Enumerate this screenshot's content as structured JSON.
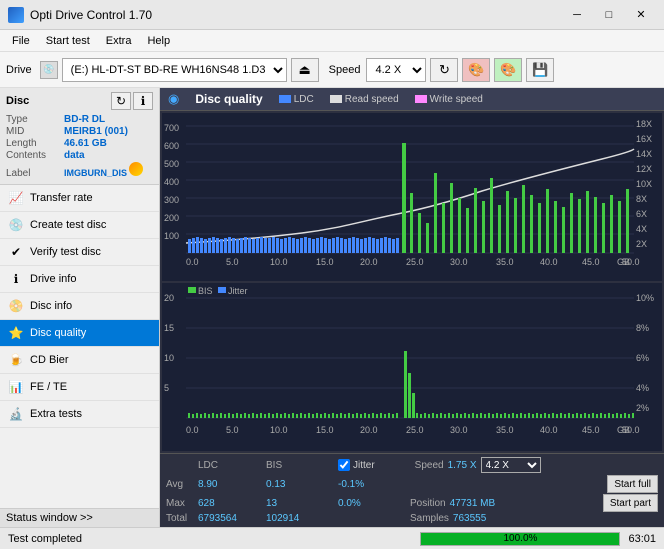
{
  "titleBar": {
    "icon": "●",
    "title": "Opti Drive Control 1.70",
    "minBtn": "─",
    "maxBtn": "□",
    "closeBtn": "✕"
  },
  "menuBar": {
    "items": [
      "File",
      "Start test",
      "Extra",
      "Help"
    ]
  },
  "toolbar": {
    "driveLabel": "Drive",
    "driveValue": "(E:)  HL-DT-ST BD-RE  WH16NS48 1.D3",
    "speedLabel": "Speed",
    "speedValue": "4.2 X"
  },
  "disc": {
    "title": "Disc",
    "refreshIcon": "↻",
    "fields": [
      {
        "key": "Type",
        "val": "BD-R DL"
      },
      {
        "key": "MID",
        "val": "MEIRB1 (001)"
      },
      {
        "key": "Length",
        "val": "46.61 GB"
      },
      {
        "key": "Contents",
        "val": "data"
      },
      {
        "key": "Label",
        "val": "IMGBURN_DIS"
      }
    ]
  },
  "navItems": [
    {
      "label": "Transfer rate",
      "icon": "📈"
    },
    {
      "label": "Create test disc",
      "icon": "💿"
    },
    {
      "label": "Verify test disc",
      "icon": "✔"
    },
    {
      "label": "Drive info",
      "icon": "ℹ"
    },
    {
      "label": "Disc info",
      "icon": "📀"
    },
    {
      "label": "Disc quality",
      "icon": "⭐",
      "active": true
    },
    {
      "label": "CD Bier",
      "icon": "🍺"
    },
    {
      "label": "FE / TE",
      "icon": "📊"
    },
    {
      "label": "Extra tests",
      "icon": "🔬"
    }
  ],
  "statusSidebar": "Status window >>",
  "discQuality": {
    "title": "Disc quality",
    "legend": [
      {
        "label": "LDC",
        "color": "#4488ff"
      },
      {
        "label": "Read speed",
        "color": "#dddddd"
      },
      {
        "label": "Write speed",
        "color": "#ff88ff"
      }
    ],
    "chart1": {
      "yMax": 700,
      "yLabels": [
        700,
        600,
        500,
        400,
        300,
        200,
        100
      ],
      "yRight": [
        "18X",
        "16X",
        "14X",
        "12X",
        "10X",
        "8X",
        "6X",
        "4X",
        "2X"
      ],
      "xLabels": [
        "0.0",
        "5.0",
        "10.0",
        "15.0",
        "20.0",
        "25.0",
        "30.0",
        "35.0",
        "40.0",
        "45.0",
        "50.0"
      ],
      "xUnit": "GB"
    },
    "chart2": {
      "title2Legend": [
        {
          "label": "BIS",
          "color": "#44cc44"
        },
        {
          "label": "Jitter",
          "color": "#4488ff"
        }
      ],
      "yMax": 20,
      "yLabels": [
        20,
        15,
        10,
        5
      ],
      "yRight": [
        "10%",
        "8%",
        "6%",
        "4%",
        "2%"
      ],
      "xLabels": [
        "0.0",
        "5.0",
        "10.0",
        "15.0",
        "20.0",
        "25.0",
        "30.0",
        "35.0",
        "40.0",
        "45.0",
        "50.0"
      ],
      "xUnit": "GB"
    }
  },
  "stats": {
    "colHeaders": [
      "",
      "LDC",
      "BIS",
      "",
      "Jitter",
      "Speed",
      ""
    ],
    "rows": [
      {
        "label": "Avg",
        "ldc": "8.90",
        "bis": "0.13",
        "jitter": "-0.1%",
        "speed": "1.75 X",
        "speedSel": "4.2 X"
      },
      {
        "label": "Max",
        "ldc": "628",
        "bis": "13",
        "jitter": "0.0%",
        "pos": "47731 MB"
      },
      {
        "label": "Total",
        "ldc": "6793564",
        "bis": "102914",
        "jitter": "",
        "samples": "763555"
      }
    ],
    "jitterChecked": true,
    "jitterLabel": "Jitter",
    "speedLabel": "Speed",
    "speedVal": "1.75 X",
    "speedSelVal": "4.2 X",
    "posLabel": "Position",
    "posVal": "47731 MB",
    "samplesLabel": "Samples",
    "samplesVal": "763555",
    "startFull": "Start full",
    "startPart": "Start part"
  },
  "bottomBar": {
    "statusText": "Test completed",
    "progress": 100,
    "progressLabel": "100.0%",
    "timeLabel": "63:01"
  }
}
